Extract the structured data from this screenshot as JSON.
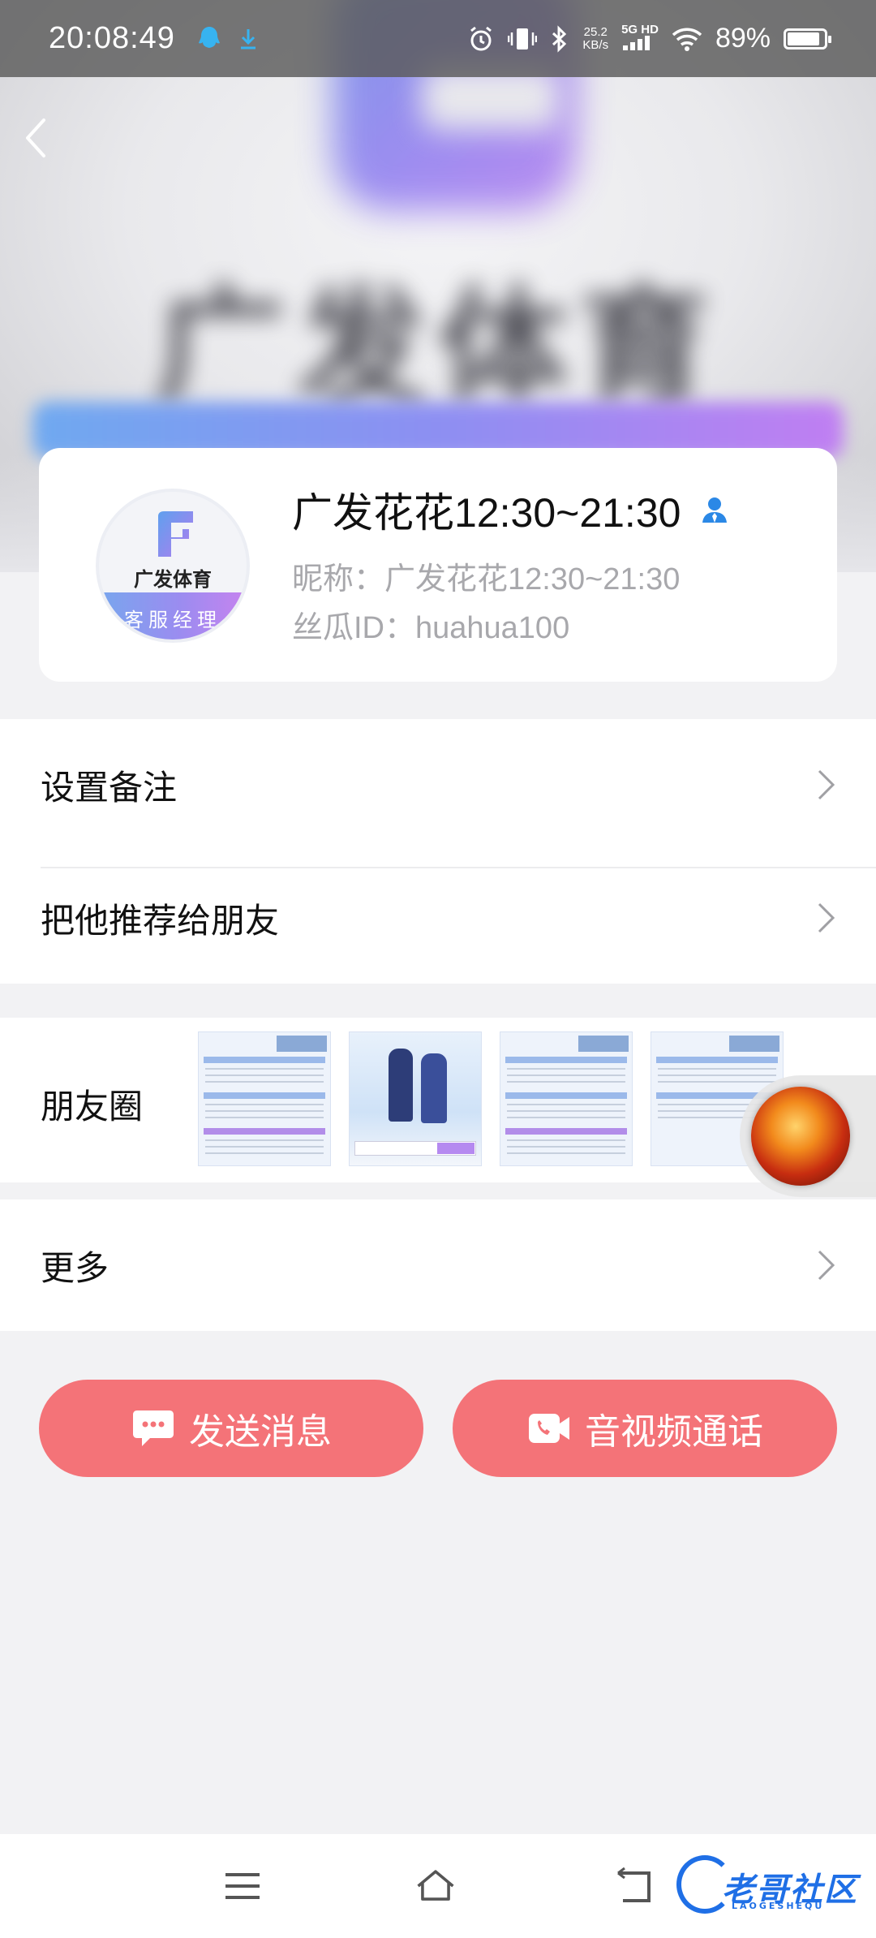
{
  "status_bar": {
    "time": "20:08:49",
    "net_speed_value": "25.2",
    "net_speed_unit": "KB/s",
    "network_type": "5G HD",
    "battery_percent": "89%",
    "battery_level": 0.89
  },
  "hero": {
    "brand_text": "广发体育"
  },
  "profile": {
    "name": "广发花花12:30~21:30",
    "nickname": "昵称：广发花花12:30~21:30",
    "id": "丝瓜ID：huahua100",
    "avatar_brand": "广发体育",
    "avatar_role": "客服经理"
  },
  "menu": {
    "set_remark": "设置备注",
    "recommend": "把他推荐给朋友",
    "moments": "朋友圈",
    "more": "更多"
  },
  "actions": {
    "send_message": "发送消息",
    "av_call": "音视频通话"
  },
  "watermark": {
    "text": "老哥社区",
    "sub": "LAOGESHEQU"
  },
  "colors": {
    "accent": "#f47378",
    "status_bar_bg": "#5a5a5a",
    "page_bg": "#f2f2f4",
    "subtext": "#a8a8ac",
    "watermark_blue": "#1f6fe6"
  }
}
